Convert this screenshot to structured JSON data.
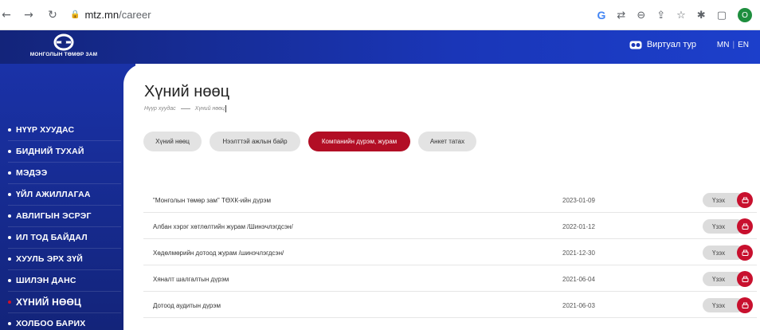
{
  "browser": {
    "url_host": "mtz.mn",
    "url_path": "/career",
    "profile_initial": "O",
    "icons": [
      "back-arrow-icon",
      "forward-arrow-icon",
      "reload-icon",
      "lock-icon",
      "google-icon",
      "translate-icon",
      "zoom-icon",
      "share-icon",
      "star-icon",
      "extensions-icon",
      "sidebar-icon",
      "profile-icon"
    ]
  },
  "header": {
    "logo_text": "МОНГОЛЫН ТӨМӨР ЗАМ",
    "virtual_tour_label": "Виртуал тур",
    "lang_mn": "MN",
    "lang_sep": "|",
    "lang_en": "EN"
  },
  "sidebar": {
    "items": [
      {
        "label": "НҮҮР ХУУДАС",
        "active": false
      },
      {
        "label": "БИДНИЙ ТУХАЙ",
        "active": false
      },
      {
        "label": "МЭДЭЭ",
        "active": false
      },
      {
        "label": "ҮЙЛ АЖИЛЛАГАА",
        "active": false
      },
      {
        "label": "АВЛИГЫН ЭСРЭГ",
        "active": false
      },
      {
        "label": "ИЛ ТОД БАЙДАЛ",
        "active": false
      },
      {
        "label": "ХУУЛЬ ЭРХ ЗҮЙ",
        "active": false
      },
      {
        "label": "ШИЛЭН ДАНС",
        "active": false
      },
      {
        "label": "ХҮНИЙ НӨӨЦ",
        "active": true
      },
      {
        "label": "ХОЛБОО БАРИХ",
        "active": false
      }
    ]
  },
  "main": {
    "title": "Хүний нөөц",
    "breadcrumb": {
      "home": "Нүүр хуудас",
      "current": "Хүний нөөц"
    },
    "tabs": [
      {
        "label": "Хүний нөөц",
        "active": false
      },
      {
        "label": "Нээлттэй ажлын байр",
        "active": false
      },
      {
        "label": "Компанийн дүрэм, журам",
        "active": true
      },
      {
        "label": "Анкет татах",
        "active": false
      }
    ],
    "documents": [
      {
        "title": "\"Монголын төмөр зам\" ТӨХК-ийн дүрэм",
        "date": "2023-01-09",
        "action": "Үзэх"
      },
      {
        "title": "Албан хэрэг хөтлөлтийн журам /Шинэчлэгдсэн/",
        "date": "2022-01-12",
        "action": "Үзэх"
      },
      {
        "title": "Хөдөлмөрийн дотоод журам /шинэчлэгдсэн/",
        "date": "2021-12-30",
        "action": "Үзэх"
      },
      {
        "title": "Хяналт шалгалтын дүрэм",
        "date": "2021-06-04",
        "action": "Үзэх"
      },
      {
        "title": "Дотоод аудитын дүрэм",
        "date": "2021-06-03",
        "action": "Үзэх"
      }
    ]
  },
  "colors": {
    "brand_blue": "#1a36b8",
    "accent_red": "#b20e25",
    "pill_gray": "#e3e3e3"
  }
}
